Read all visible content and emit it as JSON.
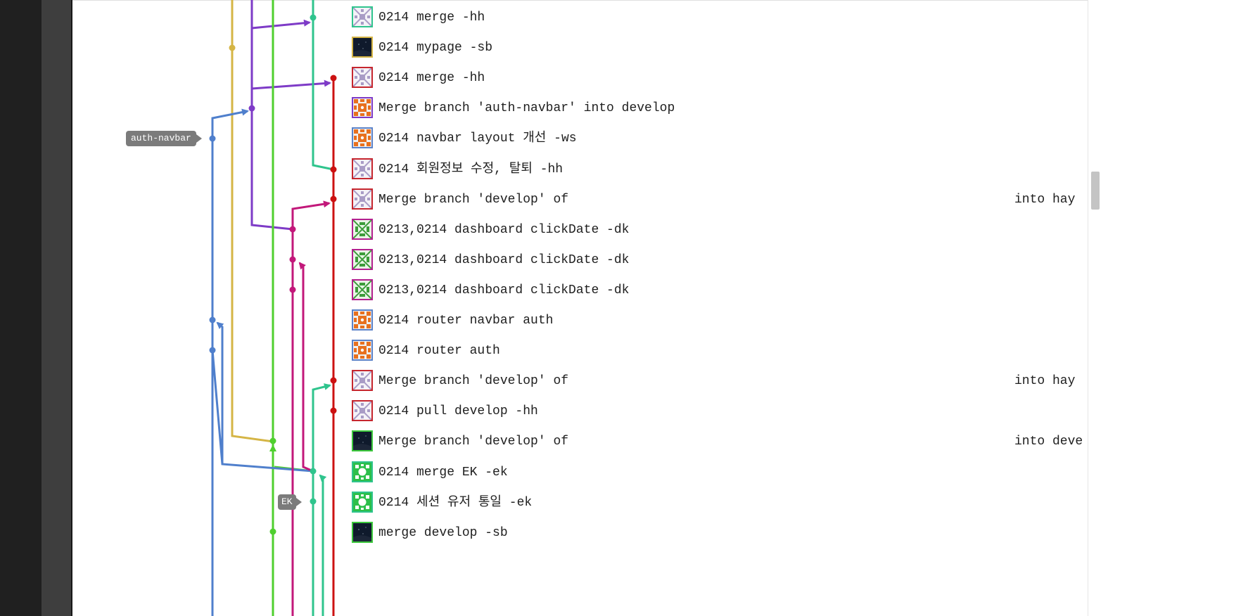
{
  "branch_tags": {
    "auth_navbar": "auth-navbar",
    "ek": "EK"
  },
  "commits": [
    {
      "message": "0214 merge -hh",
      "right_text": "",
      "avatar": "identicon-lavender",
      "border": "#2fc48d"
    },
    {
      "message": "0214 mypage -sb",
      "right_text": "",
      "avatar": "photo-dark-sky",
      "border": "#d5b545"
    },
    {
      "message": "0214 merge -hh",
      "right_text": "",
      "avatar": "identicon-lavender",
      "border": "#c6262e"
    },
    {
      "message": "Merge branch 'auth-navbar' into develop",
      "right_text": "",
      "avatar": "identicon-orange",
      "border": "#7e3bc7"
    },
    {
      "message": "0214 navbar layout 개선 -ws",
      "right_text": "",
      "avatar": "identicon-orange",
      "border": "#5b82c8"
    },
    {
      "message": "0214 회원정보 수정, 탈퇴 -hh",
      "right_text": "",
      "avatar": "identicon-lavender",
      "border": "#c6262e"
    },
    {
      "message": "Merge branch 'develop' of",
      "right_text": "into hay",
      "avatar": "identicon-lavender",
      "border": "#c6262e"
    },
    {
      "message": "0213,0214 dashboard clickDate -dk",
      "right_text": "",
      "avatar": "identicon-green-check",
      "border": "#b3208f"
    },
    {
      "message": "0213,0214 dashboard clickDate -dk",
      "right_text": "",
      "avatar": "identicon-green-check",
      "border": "#b3208f"
    },
    {
      "message": "0213,0214 dashboard clickDate -dk",
      "right_text": "",
      "avatar": "identicon-green-check",
      "border": "#b3208f"
    },
    {
      "message": "0214 router navbar auth",
      "right_text": "",
      "avatar": "identicon-orange",
      "border": "#5b82c8"
    },
    {
      "message": "0214 router auth",
      "right_text": "",
      "avatar": "identicon-orange",
      "border": "#5b82c8"
    },
    {
      "message": "Merge branch 'develop' of",
      "right_text": "into hay",
      "avatar": "identicon-lavender",
      "border": "#c6262e"
    },
    {
      "message": "0214 pull develop -hh",
      "right_text": "",
      "avatar": "identicon-lavender",
      "border": "#c6262e"
    },
    {
      "message": "Merge branch 'develop' of",
      "right_text": "into deve",
      "avatar": "photo-dark-sky",
      "border": "#3cc83c"
    },
    {
      "message": "0214 merge EK -ek",
      "right_text": "",
      "avatar": "identicon-green-pattern",
      "border": "#2fc48d"
    },
    {
      "message": "0214 세션 유저 통일 -ek",
      "right_text": "",
      "avatar": "identicon-green-pattern",
      "border": "#2fc48d"
    },
    {
      "message": "merge develop -sb",
      "right_text": "",
      "avatar": "photo-dark-sky",
      "border": "#3cc83c"
    }
  ],
  "lane_colors": {
    "yellow": "#d5b545",
    "purple": "#7e3bc7",
    "green": "#4fcf2e",
    "teal": "#2fc48d",
    "red": "#cc1111",
    "blue": "#4f7fcc",
    "magenta": "#c2187a"
  }
}
